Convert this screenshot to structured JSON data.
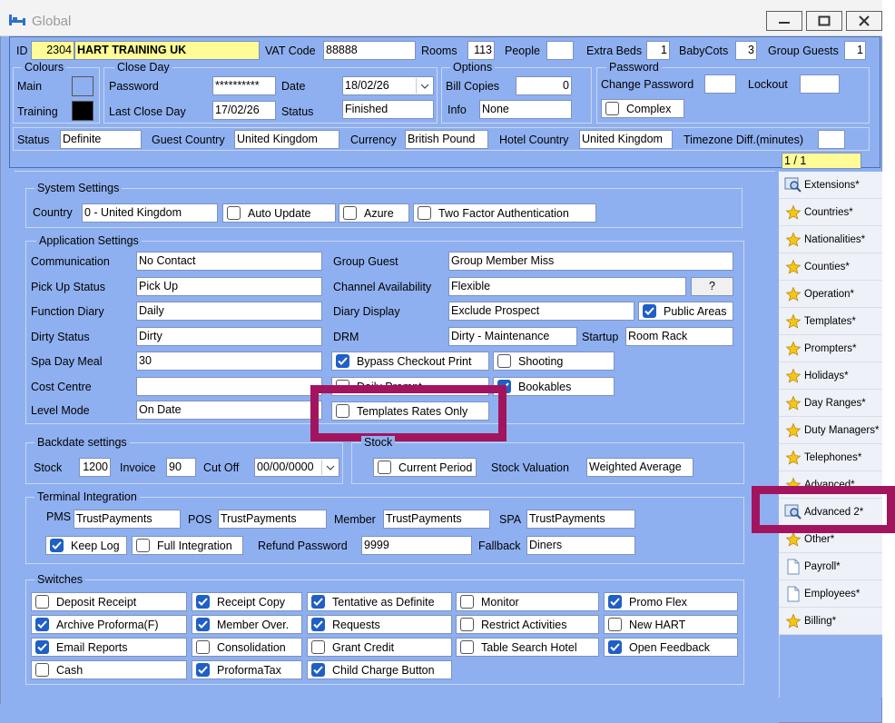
{
  "window": {
    "title": "Global",
    "minimize": "minimize",
    "maximize": "maximize",
    "close": "close"
  },
  "header": {
    "id_label": "ID",
    "id_value": "2304",
    "name_value": "HART TRAINING UK",
    "vat_label": "VAT Code",
    "vat_value": "88888",
    "rooms_label": "Rooms",
    "rooms_value": "113",
    "people_label": "People",
    "people_value": "",
    "extra_beds_label": "Extra Beds",
    "extra_beds_value": "1",
    "babycots_label": "BabyCots",
    "babycots_value": "3",
    "group_guests_label": "Group Guests",
    "group_guests_value": "1"
  },
  "colours": {
    "legend": "Colours",
    "main_label": "Main",
    "training_label": "Training",
    "main_color": "#8fb0f0",
    "training_color": "#000000"
  },
  "close_day": {
    "legend": "Close Day",
    "password_label": "Password",
    "password_value": "**********",
    "date_label": "Date",
    "date_value": "18/02/26",
    "last_close_label": "Last Close Day",
    "last_close_value": "17/02/26",
    "status_label": "Status",
    "status_value": "Finished"
  },
  "options": {
    "legend": "Options",
    "bill_copies_label": "Bill Copies",
    "bill_copies_value": "0",
    "info_label": "Info",
    "info_value": "None"
  },
  "password": {
    "legend": "Password",
    "change_label": "Change Password",
    "change_value": "",
    "lockout_label": "Lockout",
    "lockout_value": "",
    "complex_label": "Complex",
    "complex_checked": false
  },
  "status_row": {
    "status_label": "Status",
    "status_value": "Definite",
    "guest_country_label": "Guest Country",
    "guest_country_value": "United Kingdom",
    "currency_label": "Currency",
    "currency_value": "British Pound",
    "hotel_country_label": "Hotel Country",
    "hotel_country_value": "United Kingdom",
    "timezone_label": "Timezone Diff.(minutes)",
    "timezone_value": ""
  },
  "pager": "1 / 1",
  "system": {
    "legend": "System Settings",
    "country_label": "Country",
    "country_value": "0 - United Kingdom",
    "auto_update": "Auto Update",
    "azure": "Azure",
    "two_factor": "Two Factor Authentication"
  },
  "app": {
    "legend": "Application Settings",
    "communication_label": "Communication",
    "communication_value": "No Contact",
    "pickup_label": "Pick Up Status",
    "pickup_value": "Pick Up",
    "function_label": "Function Diary",
    "function_value": "Daily",
    "dirty_label": "Dirty Status",
    "dirty_value": "Dirty",
    "spa_label": "Spa Day Meal",
    "spa_value": "30",
    "cost_label": "Cost Centre",
    "cost_value": "",
    "level_label": "Level Mode",
    "level_value": "On Date",
    "group_guest_label": "Group Guest",
    "group_guest_value": "Group Member Miss",
    "channel_label": "Channel Availability",
    "channel_value": "Flexible",
    "channel_btn": "?",
    "diary_label": "Diary Display",
    "diary_value": "Exclude Prospect",
    "public_areas": "Public Areas",
    "drm_label": "DRM",
    "drm_value": "Dirty - Maintenance",
    "startup_label": "Startup",
    "startup_value": "Room Rack",
    "bypass": "Bypass Checkout Print",
    "shooting": "Shooting",
    "daily_prompt": "Daily Prompt",
    "bookables": "Bookables",
    "templates_rates": "Templates Rates Only"
  },
  "backdate": {
    "legend": "Backdate settings",
    "stock_label": "Stock",
    "stock_value": "1200",
    "invoice_label": "Invoice",
    "invoice_value": "90",
    "cutoff_label": "Cut Off",
    "cutoff_value": "00/00/0000"
  },
  "stock": {
    "legend": "Stock",
    "current_period": "Current Period",
    "valuation_label": "Stock Valuation",
    "valuation_value": "Weighted Average"
  },
  "terminal": {
    "legend": "Terminal Integration",
    "pms_label": "PMS",
    "pms_value": "TrustPayments",
    "pos_label": "POS",
    "pos_value": "TrustPayments",
    "member_label": "Member",
    "member_value": "TrustPayments",
    "spa_label": "SPA",
    "spa_value": "TrustPayments",
    "keep_log": "Keep Log",
    "full_integration": "Full Integration",
    "refund_label": "Refund Password",
    "refund_value": "9999",
    "fallback_label": "Fallback",
    "fallback_value": "Diners"
  },
  "switches": {
    "legend": "Switches",
    "items": [
      {
        "label": "Deposit Receipt",
        "checked": false
      },
      {
        "label": "Receipt Copy",
        "checked": true
      },
      {
        "label": "Tentative as Definite",
        "checked": true
      },
      {
        "label": "Monitor",
        "checked": false
      },
      {
        "label": "Promo Flex",
        "checked": true
      },
      {
        "label": "Archive Proforma(F)",
        "checked": true
      },
      {
        "label": "Member Over.",
        "checked": true
      },
      {
        "label": "Requests",
        "checked": true
      },
      {
        "label": "Restrict Activities",
        "checked": false
      },
      {
        "label": "New HART",
        "checked": false
      },
      {
        "label": "Email Reports",
        "checked": true
      },
      {
        "label": "Consolidation",
        "checked": false
      },
      {
        "label": "Grant Credit",
        "checked": false
      },
      {
        "label": "Table Search Hotel",
        "checked": false
      },
      {
        "label": "Open Feedback",
        "checked": true
      },
      {
        "label": "Cash",
        "checked": false
      },
      {
        "label": "ProformaTax",
        "checked": true
      },
      {
        "label": "Child Charge Button",
        "checked": true
      }
    ]
  },
  "sidebar": {
    "items": [
      {
        "label": "Extensions*",
        "icon": "magnifier-icon"
      },
      {
        "label": "Countries*",
        "icon": "star-icon"
      },
      {
        "label": "Nationalities*",
        "icon": "star-icon"
      },
      {
        "label": "Counties*",
        "icon": "star-icon"
      },
      {
        "label": "Operation*",
        "icon": "star-icon"
      },
      {
        "label": "Templates*",
        "icon": "star-icon"
      },
      {
        "label": "Prompters*",
        "icon": "star-icon"
      },
      {
        "label": "Holidays*",
        "icon": "star-icon"
      },
      {
        "label": "Day Ranges*",
        "icon": "star-icon"
      },
      {
        "label": "Duty Managers*",
        "icon": "star-icon"
      },
      {
        "label": "Telephones*",
        "icon": "star-icon"
      },
      {
        "label": "Advanced*",
        "icon": "star-icon"
      },
      {
        "label": "Advanced 2*",
        "icon": "magnifier-icon"
      },
      {
        "label": "Other*",
        "icon": "star-icon"
      },
      {
        "label": "Payroll*",
        "icon": "page-icon"
      },
      {
        "label": "Employees*",
        "icon": "page-icon"
      },
      {
        "label": "Billing*",
        "icon": "star-icon"
      }
    ]
  },
  "colors": {
    "highlight": "#a3145e",
    "accent": "#1f5fc6",
    "panel": "#8fb0f0",
    "id_field": "#fffb96"
  }
}
